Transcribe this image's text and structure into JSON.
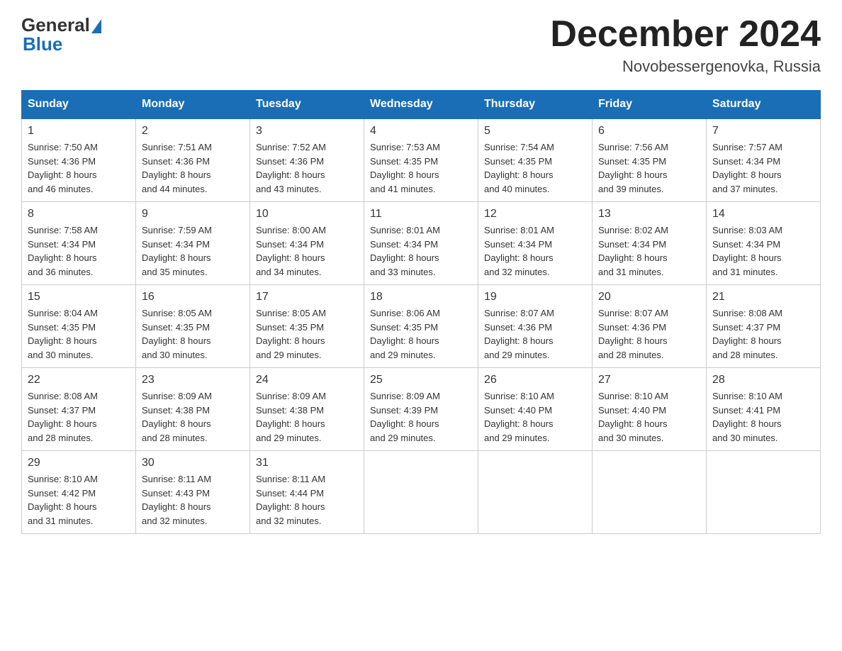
{
  "header": {
    "logo_general": "General",
    "logo_blue": "Blue",
    "month_title": "December 2024",
    "location": "Novobessergenovka, Russia"
  },
  "days_of_week": [
    "Sunday",
    "Monday",
    "Tuesday",
    "Wednesday",
    "Thursday",
    "Friday",
    "Saturday"
  ],
  "weeks": [
    [
      {
        "day": "1",
        "sunrise": "7:50 AM",
        "sunset": "4:36 PM",
        "daylight": "8 hours and 46 minutes."
      },
      {
        "day": "2",
        "sunrise": "7:51 AM",
        "sunset": "4:36 PM",
        "daylight": "8 hours and 44 minutes."
      },
      {
        "day": "3",
        "sunrise": "7:52 AM",
        "sunset": "4:36 PM",
        "daylight": "8 hours and 43 minutes."
      },
      {
        "day": "4",
        "sunrise": "7:53 AM",
        "sunset": "4:35 PM",
        "daylight": "8 hours and 41 minutes."
      },
      {
        "day": "5",
        "sunrise": "7:54 AM",
        "sunset": "4:35 PM",
        "daylight": "8 hours and 40 minutes."
      },
      {
        "day": "6",
        "sunrise": "7:56 AM",
        "sunset": "4:35 PM",
        "daylight": "8 hours and 39 minutes."
      },
      {
        "day": "7",
        "sunrise": "7:57 AM",
        "sunset": "4:34 PM",
        "daylight": "8 hours and 37 minutes."
      }
    ],
    [
      {
        "day": "8",
        "sunrise": "7:58 AM",
        "sunset": "4:34 PM",
        "daylight": "8 hours and 36 minutes."
      },
      {
        "day": "9",
        "sunrise": "7:59 AM",
        "sunset": "4:34 PM",
        "daylight": "8 hours and 35 minutes."
      },
      {
        "day": "10",
        "sunrise": "8:00 AM",
        "sunset": "4:34 PM",
        "daylight": "8 hours and 34 minutes."
      },
      {
        "day": "11",
        "sunrise": "8:01 AM",
        "sunset": "4:34 PM",
        "daylight": "8 hours and 33 minutes."
      },
      {
        "day": "12",
        "sunrise": "8:01 AM",
        "sunset": "4:34 PM",
        "daylight": "8 hours and 32 minutes."
      },
      {
        "day": "13",
        "sunrise": "8:02 AM",
        "sunset": "4:34 PM",
        "daylight": "8 hours and 31 minutes."
      },
      {
        "day": "14",
        "sunrise": "8:03 AM",
        "sunset": "4:34 PM",
        "daylight": "8 hours and 31 minutes."
      }
    ],
    [
      {
        "day": "15",
        "sunrise": "8:04 AM",
        "sunset": "4:35 PM",
        "daylight": "8 hours and 30 minutes."
      },
      {
        "day": "16",
        "sunrise": "8:05 AM",
        "sunset": "4:35 PM",
        "daylight": "8 hours and 30 minutes."
      },
      {
        "day": "17",
        "sunrise": "8:05 AM",
        "sunset": "4:35 PM",
        "daylight": "8 hours and 29 minutes."
      },
      {
        "day": "18",
        "sunrise": "8:06 AM",
        "sunset": "4:35 PM",
        "daylight": "8 hours and 29 minutes."
      },
      {
        "day": "19",
        "sunrise": "8:07 AM",
        "sunset": "4:36 PM",
        "daylight": "8 hours and 29 minutes."
      },
      {
        "day": "20",
        "sunrise": "8:07 AM",
        "sunset": "4:36 PM",
        "daylight": "8 hours and 28 minutes."
      },
      {
        "day": "21",
        "sunrise": "8:08 AM",
        "sunset": "4:37 PM",
        "daylight": "8 hours and 28 minutes."
      }
    ],
    [
      {
        "day": "22",
        "sunrise": "8:08 AM",
        "sunset": "4:37 PM",
        "daylight": "8 hours and 28 minutes."
      },
      {
        "day": "23",
        "sunrise": "8:09 AM",
        "sunset": "4:38 PM",
        "daylight": "8 hours and 28 minutes."
      },
      {
        "day": "24",
        "sunrise": "8:09 AM",
        "sunset": "4:38 PM",
        "daylight": "8 hours and 29 minutes."
      },
      {
        "day": "25",
        "sunrise": "8:09 AM",
        "sunset": "4:39 PM",
        "daylight": "8 hours and 29 minutes."
      },
      {
        "day": "26",
        "sunrise": "8:10 AM",
        "sunset": "4:40 PM",
        "daylight": "8 hours and 29 minutes."
      },
      {
        "day": "27",
        "sunrise": "8:10 AM",
        "sunset": "4:40 PM",
        "daylight": "8 hours and 30 minutes."
      },
      {
        "day": "28",
        "sunrise": "8:10 AM",
        "sunset": "4:41 PM",
        "daylight": "8 hours and 30 minutes."
      }
    ],
    [
      {
        "day": "29",
        "sunrise": "8:10 AM",
        "sunset": "4:42 PM",
        "daylight": "8 hours and 31 minutes."
      },
      {
        "day": "30",
        "sunrise": "8:11 AM",
        "sunset": "4:43 PM",
        "daylight": "8 hours and 32 minutes."
      },
      {
        "day": "31",
        "sunrise": "8:11 AM",
        "sunset": "4:44 PM",
        "daylight": "8 hours and 32 minutes."
      },
      null,
      null,
      null,
      null
    ]
  ],
  "labels": {
    "sunrise": "Sunrise:",
    "sunset": "Sunset:",
    "daylight": "Daylight:"
  }
}
